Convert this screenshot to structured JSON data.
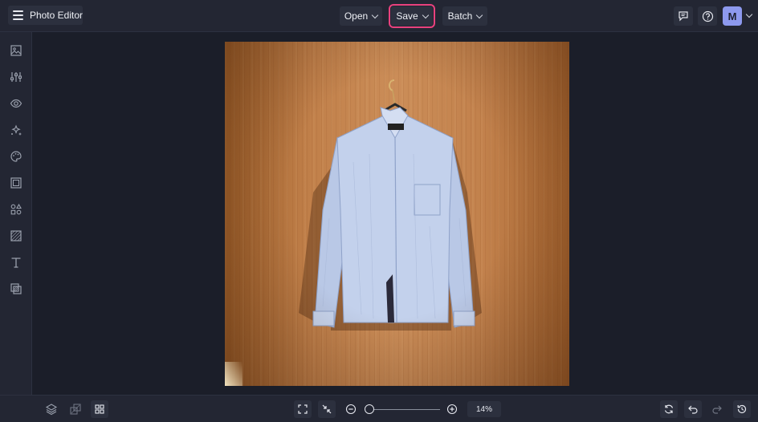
{
  "app": {
    "title": "Photo Editor"
  },
  "toolbar": {
    "open_label": "Open",
    "save_label": "Save",
    "batch_label": "Batch"
  },
  "user": {
    "avatar_initial": "M"
  },
  "zoom": {
    "level": "14%",
    "slider_fraction": 0.0
  },
  "colors": {
    "background": "#1b1e29",
    "panel": "#232633",
    "button": "#2c303e",
    "save_highlight": "#e8417d",
    "avatar": "#8d99ee"
  },
  "sidebar_icons": [
    "image-icon",
    "adjust-sliders-icon",
    "eye-icon",
    "sparkle-effects-icon",
    "palette-icon",
    "frame-icon",
    "graphics-icon",
    "texture-icon",
    "text-icon",
    "overlay-icon"
  ],
  "bottom_icons": [
    "layers-icon",
    "transform-icon",
    "grid-icon",
    "fit-screen-icon",
    "actual-size-icon",
    "zoom-out-icon",
    "zoom-in-icon",
    "sync-icon",
    "undo-icon",
    "redo-icon",
    "history-icon"
  ]
}
